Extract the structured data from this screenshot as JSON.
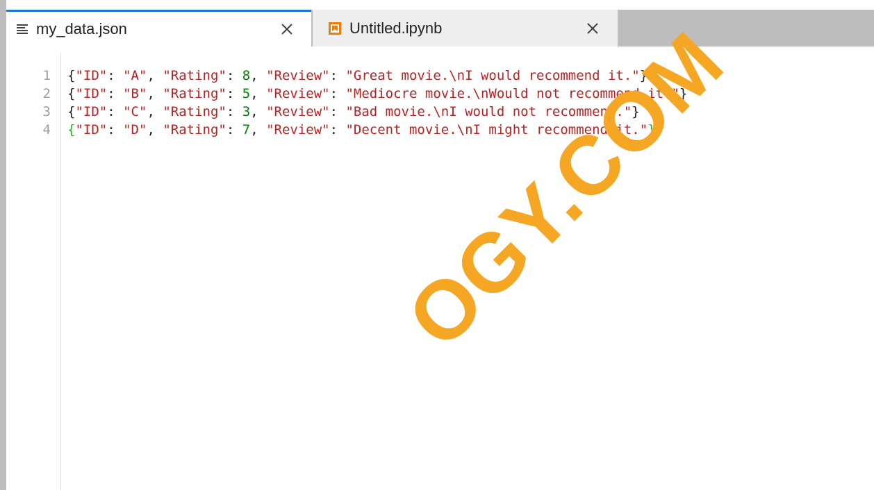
{
  "tabs": [
    {
      "label": "my_data.json",
      "icon": "text-file-icon",
      "active": true,
      "close_icon": "close-icon"
    },
    {
      "label": "Untitled.ipynb",
      "icon": "notebook-icon",
      "active": false,
      "close_icon": "close-icon"
    }
  ],
  "editor": {
    "line_numbers": [
      "1",
      "2",
      "3",
      "4"
    ],
    "lines": [
      {
        "tokens": [
          {
            "t": "{",
            "k": "punct"
          },
          {
            "t": "\"ID\"",
            "k": "str"
          },
          {
            "t": ": ",
            "k": "punct"
          },
          {
            "t": "\"A\"",
            "k": "str"
          },
          {
            "t": ", ",
            "k": "punct"
          },
          {
            "t": "\"Rating\"",
            "k": "str"
          },
          {
            "t": ": ",
            "k": "punct"
          },
          {
            "t": "8",
            "k": "num"
          },
          {
            "t": ", ",
            "k": "punct"
          },
          {
            "t": "\"Review\"",
            "k": "str"
          },
          {
            "t": ": ",
            "k": "punct"
          },
          {
            "t": "\"Great movie.\\nI would recommend it.\"",
            "k": "str"
          },
          {
            "t": "}",
            "k": "punct"
          }
        ]
      },
      {
        "tokens": [
          {
            "t": "{",
            "k": "punct"
          },
          {
            "t": "\"ID\"",
            "k": "str"
          },
          {
            "t": ": ",
            "k": "punct"
          },
          {
            "t": "\"B\"",
            "k": "str"
          },
          {
            "t": ", ",
            "k": "punct"
          },
          {
            "t": "\"Rating\"",
            "k": "str"
          },
          {
            "t": ": ",
            "k": "punct"
          },
          {
            "t": "5",
            "k": "num"
          },
          {
            "t": ", ",
            "k": "punct"
          },
          {
            "t": "\"Review\"",
            "k": "str"
          },
          {
            "t": ": ",
            "k": "punct"
          },
          {
            "t": "\"Mediocre movie.\\nWould not recommend it.\"",
            "k": "str"
          },
          {
            "t": "}",
            "k": "punct"
          }
        ]
      },
      {
        "tokens": [
          {
            "t": "{",
            "k": "punct"
          },
          {
            "t": "\"ID\"",
            "k": "str"
          },
          {
            "t": ": ",
            "k": "punct"
          },
          {
            "t": "\"C\"",
            "k": "str"
          },
          {
            "t": ", ",
            "k": "punct"
          },
          {
            "t": "\"Rating\"",
            "k": "str"
          },
          {
            "t": ": ",
            "k": "punct"
          },
          {
            "t": "3",
            "k": "num"
          },
          {
            "t": ", ",
            "k": "punct"
          },
          {
            "t": "\"Review\"",
            "k": "str"
          },
          {
            "t": ": ",
            "k": "punct"
          },
          {
            "t": "\"Bad movie.\\nI would not recommend.\"",
            "k": "str"
          },
          {
            "t": "}",
            "k": "punct"
          }
        ]
      },
      {
        "tokens": [
          {
            "t": "{",
            "k": "bracket-match"
          },
          {
            "t": "\"ID\"",
            "k": "str"
          },
          {
            "t": ": ",
            "k": "punct"
          },
          {
            "t": "\"D\"",
            "k": "str"
          },
          {
            "t": ", ",
            "k": "punct"
          },
          {
            "t": "\"Rating\"",
            "k": "str"
          },
          {
            "t": ": ",
            "k": "punct"
          },
          {
            "t": "7",
            "k": "num"
          },
          {
            "t": ", ",
            "k": "punct"
          },
          {
            "t": "\"Review\"",
            "k": "str"
          },
          {
            "t": ": ",
            "k": "punct"
          },
          {
            "t": "\"Decent movie.\\nI might recommend it.\"",
            "k": "str"
          },
          {
            "t": "}",
            "k": "bracket-match"
          }
        ],
        "cursor_at_end": true
      }
    ]
  },
  "watermark": "OGY.COM",
  "colors": {
    "active_tab_accent": "#1976d2",
    "string": "#ba2121",
    "number": "#008000",
    "bracket_match": "#22bb22",
    "notebook_icon": "#f57c00",
    "watermark": "#f5a623"
  }
}
